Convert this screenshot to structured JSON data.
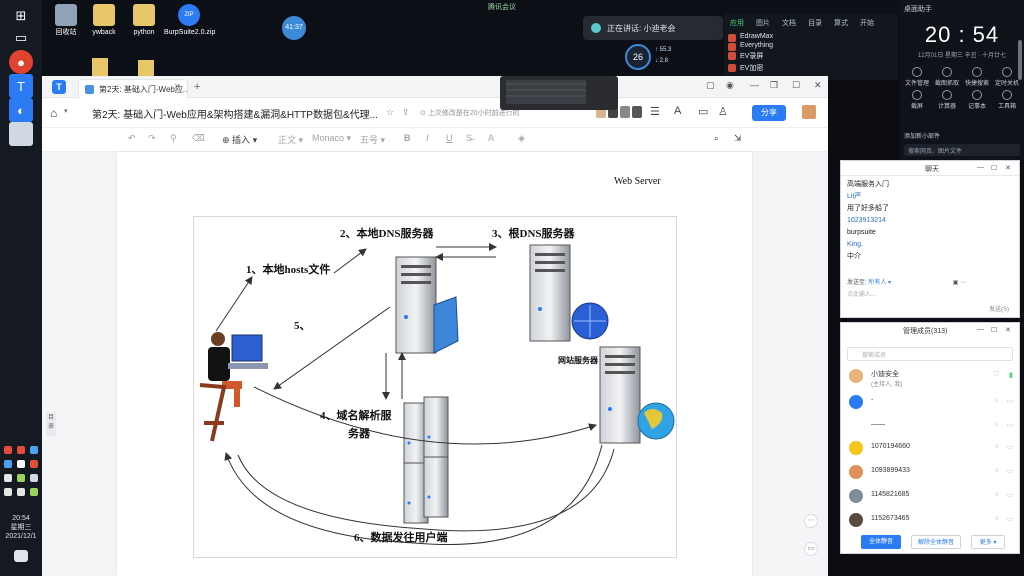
{
  "desktop": {
    "icons": [
      {
        "label": "回收站"
      },
      {
        "label": "ywback"
      },
      {
        "label": "python"
      },
      {
        "label": "BurpSuite2.0.zip"
      }
    ],
    "floating_badge": "41:37",
    "top_label": "腾讯会议",
    "wechat_bubble": "正在讲话: 小迪老会",
    "net": {
      "percent": "26",
      "up": "55.3",
      "down": "2.8"
    }
  },
  "right_column": {
    "tabs": [
      "应用",
      "图片",
      "文档",
      "目录",
      "算式",
      "开始"
    ],
    "apps": [
      "EdrawMax",
      "Everything",
      "EV录屏",
      "EV加密"
    ]
  },
  "clock_panel": {
    "title": "桌面助手",
    "time": "20 : 54",
    "date": "12月01日  星期三",
    "lunar": "辛丑 · 十月廿七",
    "actions": [
      "文件管理",
      "截图抓取",
      "快捷搜索",
      "定时关机",
      "截屏",
      "计算器",
      "记事本",
      "工具箱"
    ],
    "msg_link": "添加新小部件",
    "search": "搜索网页、图片文件"
  },
  "taskbar": {
    "clock_time": "20:54",
    "clock_day": "星期三",
    "clock_date": "2021/12/1"
  },
  "app": {
    "tab_title": "第2天: 基础入门-Web应...",
    "doc_title": "第2天: 基础入门-Web应用&架构搭建&漏洞&HTTP数据包&代理...",
    "saved_note": "上次修改是在20小时前进行的",
    "share": "分享",
    "toolbar": [
      "插入",
      "正文",
      "Monaco",
      "五号"
    ],
    "side_tab": "目录"
  },
  "diagram": {
    "labels": {
      "dns_local": "2、本地DNS服务器",
      "root_dns": "3、根DNS服务器",
      "hosts": "1、本地hosts文件",
      "step5": "5、",
      "domain_server": "4、域名解析服",
      "domain_server2": "务器",
      "web_server_cn": "网站服务器",
      "send_back": "6、数据发往用户端",
      "web_server": "Web Server"
    }
  },
  "chat": {
    "title": "聊天",
    "messages": [
      {
        "text": "高端服务入门",
        "blue": false
      },
      {
        "text": "Lit严",
        "blue": true
      },
      {
        "text": "用了好多船了",
        "blue": false
      },
      {
        "text": "1023913214",
        "blue": true
      },
      {
        "text": "burpsuite",
        "blue": false
      },
      {
        "text": "King.",
        "blue": true
      },
      {
        "text": "中介",
        "blue": false
      }
    ],
    "send_to_label": "发送至:",
    "send_to_value": "所有人",
    "input_placeholder": "点此输入...",
    "send_button": "发送(S)"
  },
  "members": {
    "title": "管理成员(313)",
    "search_placeholder": "搜索成员",
    "rows": [
      {
        "name": "小迪安全",
        "sub": "(主持人, 我)",
        "color": "#e6b37a"
      },
      {
        "name": "-",
        "sub": "",
        "color": "#2b7bf4"
      },
      {
        "name": "——",
        "sub": "",
        "color": "#ffffff"
      },
      {
        "name": "1070194660",
        "sub": "",
        "color": "#f5c518"
      },
      {
        "name": "1093899433",
        "sub": "",
        "color": "#e0905a"
      },
      {
        "name": "1145821685",
        "sub": "",
        "color": "#7f8c9a"
      },
      {
        "name": "1152673465",
        "sub": "",
        "color": "#5a4a3f"
      }
    ],
    "btn_mute_all": "全体静音",
    "btn_unmute_all": "解除全体静音",
    "btn_more": "更多"
  }
}
